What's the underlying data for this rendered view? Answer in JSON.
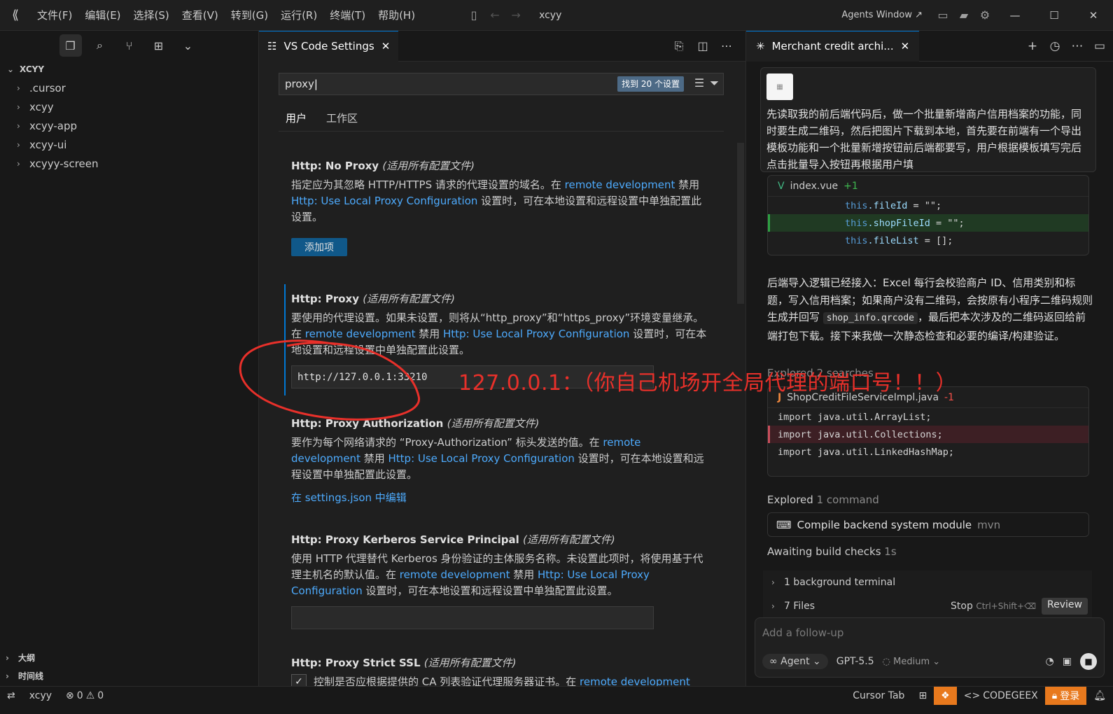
{
  "titlebar": {
    "menus": [
      "文件(F)",
      "编辑(E)",
      "选择(S)",
      "查看(V)",
      "转到(G)",
      "运行(R)",
      "终端(T)",
      "帮助(H)"
    ],
    "title": "xcyy",
    "agents_window": "Agents Window ↗"
  },
  "explorer": {
    "root": "XCYY",
    "items": [
      ".cursor",
      "xcyy",
      "xcyy-app",
      "xcyy-ui",
      "xcyyy-screen"
    ],
    "outline": "大纲",
    "timeline": "时间线"
  },
  "editor": {
    "tab_label": "VS Code Settings",
    "search_value": "proxy",
    "found_badge": "找到 20 个设置",
    "scope_user": "用户",
    "scope_workspace": "工作区",
    "settings": [
      {
        "title": "Http: No Proxy",
        "scope": "(适用所有配置文件)",
        "desc_a": "指定应为其忽略 HTTP/HTTPS 请求的代理设置的域名。在 ",
        "link1": "remote development",
        "desc_b": " 禁用 ",
        "link2": "Http: Use Local Proxy Configuration",
        "desc_c": " 设置时，可在本地设置和远程设置中单独配置此设置。",
        "button": "添加项"
      },
      {
        "title": "Http: Proxy",
        "scope": "(适用所有配置文件)",
        "desc_a": "要使用的代理设置。如果未设置，则将从“http_proxy”和“https_proxy”环境变量继承。在 ",
        "link1": "remote development",
        "desc_b": " 禁用 ",
        "link2": "Http: Use Local Proxy Configuration",
        "desc_c": " 设置时，可在本地设置和远程设置中单独配置此设置。",
        "value": "http://127.0.0.1:33210"
      },
      {
        "title": "Http: Proxy Authorization",
        "scope": "(适用所有配置文件)",
        "desc_a": "要作为每个网络请求的 “Proxy-Authorization” 标头发送的值。在 ",
        "link1": "remote development",
        "desc_b": " 禁用 ",
        "link2": "Http: Use Local Proxy Configuration",
        "desc_c": " 设置时，可在本地设置和远程设置中单独配置此设置。",
        "edit_json": "在 settings.json 中编辑"
      },
      {
        "title": "Http: Proxy Kerberos Service Principal",
        "scope": "(适用所有配置文件)",
        "desc_a": "使用 HTTP 代理替代 Kerberos 身份验证的主体服务名称。未设置此项时，将使用基于代理主机名的默认值。在 ",
        "link1": "remote development",
        "desc_b": " 禁用 ",
        "link2": "Http: Use Local Proxy Configuration",
        "desc_c": " 设置时，可在本地设置和远程设置中单独配置此设置。",
        "value": ""
      },
      {
        "title": "Http: Proxy Strict SSL",
        "scope": "(适用所有配置文件)",
        "desc_a": "控制是否应根据提供的 CA 列表验证代理服务器证书。在 ",
        "link1": "remote development",
        "checked": true
      }
    ]
  },
  "annotation": {
    "text": "127.0.0.1：（你自己机场开全局代理的端口号！！）"
  },
  "agent": {
    "tab_label": "Merchant credit archi...",
    "user_message": "先读取我的前后端代码后，做一个批量新增商户信用档案的功能，同时要生成二维码，然后把图片下载到本地，首先要在前端有一个导出模板功能和一个批量新增按钮前后端都要写，用户根据模板填写完后点击批量导入按钮再根据用户填",
    "diff1": {
      "file": "index.vue",
      "delta": "+1",
      "lines": [
        {
          "this": "this",
          "field": ".fileId",
          "rest": " = \"\";",
          "kind": "ctx"
        },
        {
          "this": "this",
          "field": ".shopFileId",
          "rest": " = \"\";",
          "kind": "added"
        },
        {
          "this": "this",
          "field": ".fileList",
          "rest": " = [];",
          "kind": "ctx"
        }
      ]
    },
    "para_a": "后端导入逻辑已经接入：Excel 每行会校验商户 ID、信用类别和标题，写入信用档案；如果商户没有二维码，会按原有小程序二维码规则生成并回写 ",
    "para_code": "shop_info.qrcode",
    "para_b": "，最后把本次涉及的二维码返回给前端打包下载。接下来我做一次静态检查和必要的编译/构建验证。",
    "explored_search": "Explored 2 searches",
    "diff2": {
      "file": "ShopCreditFileServiceImpl.java",
      "delta": "-1",
      "lines": [
        {
          "kw": "import",
          "rest": " java.util.ArrayList;",
          "kind": "ctx"
        },
        {
          "kw": "import",
          "rest": " java.util.Collections;",
          "kind": "removed"
        },
        {
          "kw": "import",
          "rest": " java.util.LinkedHashMap;",
          "kind": "ctx"
        }
      ]
    },
    "explored_label": "Explored",
    "explored_count": "1 command",
    "command": "Compile backend system module",
    "command_tool": "mvn",
    "awaiting": "Awaiting build checks",
    "awaiting_time": "1s",
    "background_terminal": "1 background terminal",
    "files": "7 Files",
    "stop": "Stop",
    "stop_kbd": "Ctrl+Shift+⌫",
    "review": "Review",
    "composer_placeholder": "Add a follow-up",
    "mode": "Agent",
    "model": "GPT-5.5",
    "effort": "Medium"
  },
  "statusbar": {
    "branch": "xcyy",
    "errors": "0",
    "warnings": "0",
    "cursor_tab": "Cursor Tab",
    "codegeex": "CODEGEEX",
    "login": "登录"
  },
  "colors": {
    "accent": "#0078d4",
    "link": "#4daafc",
    "annotation": "#e8302a",
    "status_orange": "#e8791d"
  }
}
